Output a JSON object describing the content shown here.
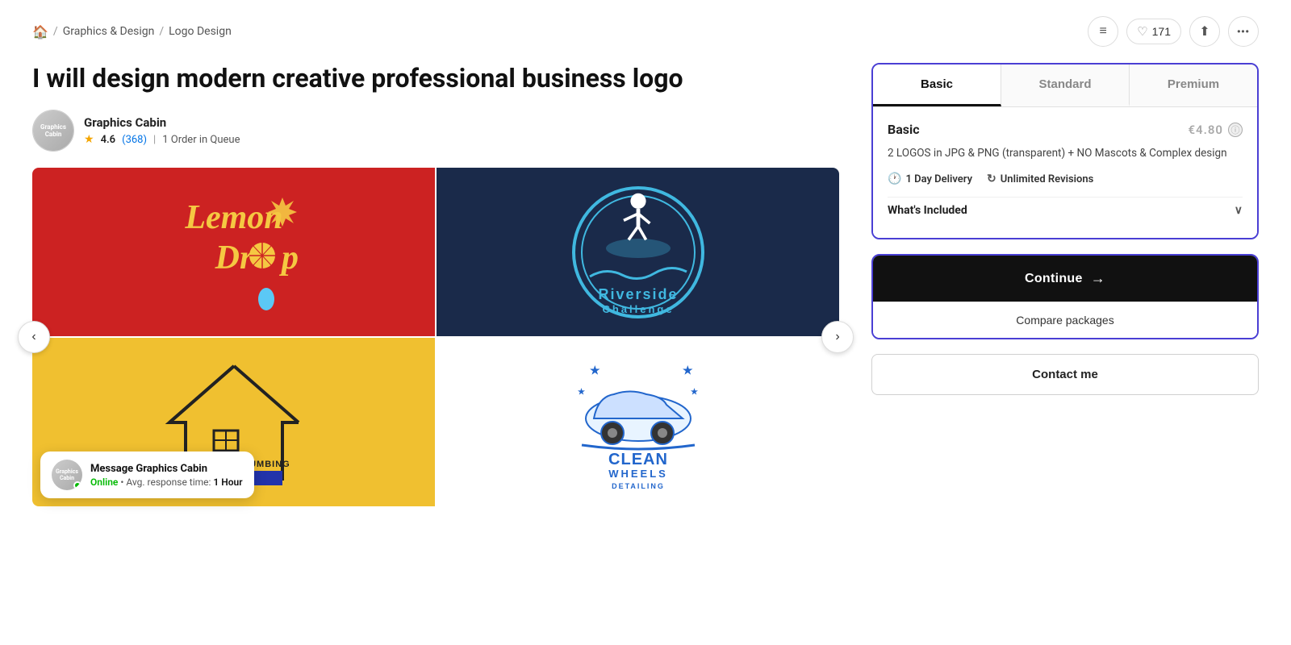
{
  "breadcrumb": {
    "home_icon": "🏠",
    "separator": "/",
    "category": "Graphics & Design",
    "subcategory": "Logo Design"
  },
  "top_actions": {
    "menu_icon": "≡",
    "heart_icon": "♡",
    "likes_count": "171",
    "share_icon": "⬆",
    "more_icon": "•••"
  },
  "gig": {
    "title": "I will design modern creative professional business logo",
    "seller": {
      "name": "Graphics Cabin",
      "avatar_text": "Graphics\nCabin",
      "rating": "4.6",
      "review_count": "368",
      "review_label": "(368)",
      "queue": "1 Order in Queue"
    }
  },
  "gallery": {
    "prev_label": "‹",
    "next_label": "›",
    "cells": [
      {
        "id": "lemon-drop",
        "bg": "#cc2222"
      },
      {
        "id": "riverside",
        "bg": "#1a2a4a"
      },
      {
        "id": "heating",
        "bg": "#f0c030"
      },
      {
        "id": "cleanwheels",
        "bg": "#ffffff"
      }
    ]
  },
  "message_popup": {
    "avatar_text": "Graphics\nCabin",
    "name": "Message Graphics Cabin",
    "online_label": "Online",
    "separator": "•",
    "avg_response": "Avg. response time:",
    "response_time": "1 Hour"
  },
  "packages": {
    "tabs": [
      {
        "id": "basic",
        "label": "Basic",
        "active": true
      },
      {
        "id": "standard",
        "label": "Standard",
        "active": false
      },
      {
        "id": "premium",
        "label": "Premium",
        "active": false
      }
    ],
    "active_tab": "basic",
    "basic": {
      "name": "Basic",
      "price": "€4.80",
      "info_icon": "ⓘ",
      "description": "2 LOGOS in JPG & PNG (transparent) + NO Mascots & Complex design",
      "features": [
        {
          "icon": "🕐",
          "label": "1 Day Delivery"
        },
        {
          "icon": "↻",
          "label": "Unlimited Revisions"
        }
      ],
      "whats_included_label": "What's Included",
      "chevron": "∨"
    }
  },
  "actions": {
    "continue_label": "Continue",
    "continue_arrow": "→",
    "compare_label": "Compare packages",
    "contact_label": "Contact me"
  }
}
